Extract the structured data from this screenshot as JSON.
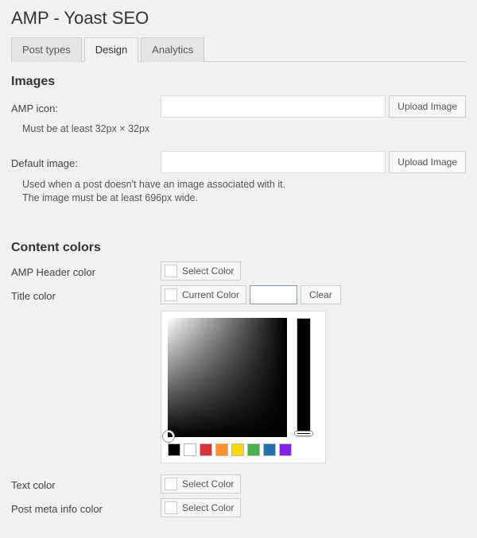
{
  "page": {
    "title": "AMP - Yoast SEO"
  },
  "tabs": [
    {
      "label": "Post types",
      "active": false
    },
    {
      "label": "Design",
      "active": true
    },
    {
      "label": "Analytics",
      "active": false
    }
  ],
  "sections": {
    "images": {
      "heading": "Images",
      "amp_icon": {
        "label": "AMP icon:",
        "value": "",
        "button": "Upload Image",
        "helper": "Must be at least 32px × 32px"
      },
      "default_image": {
        "label": "Default image:",
        "value": "",
        "button": "Upload Image",
        "helper_line1": "Used when a post doesn't have an image associated with it.",
        "helper_line2": "The image must be at least 696px wide."
      }
    },
    "colors": {
      "heading": "Content colors",
      "header_color": {
        "label": "AMP Header color",
        "button": "Select Color"
      },
      "title_color": {
        "label": "Title color",
        "current_button": "Current Color",
        "value": "",
        "clear_button": "Clear",
        "picker": {
          "palette": [
            "#000000",
            "#ffffff",
            "#d63638",
            "#ff922b",
            "#f5d90a",
            "#4caf50",
            "#2271b1",
            "#8224e3"
          ]
        }
      },
      "text_color": {
        "label": "Text color",
        "button": "Select Color"
      },
      "post_meta_color": {
        "label": "Post meta info color",
        "button": "Select Color"
      }
    }
  }
}
